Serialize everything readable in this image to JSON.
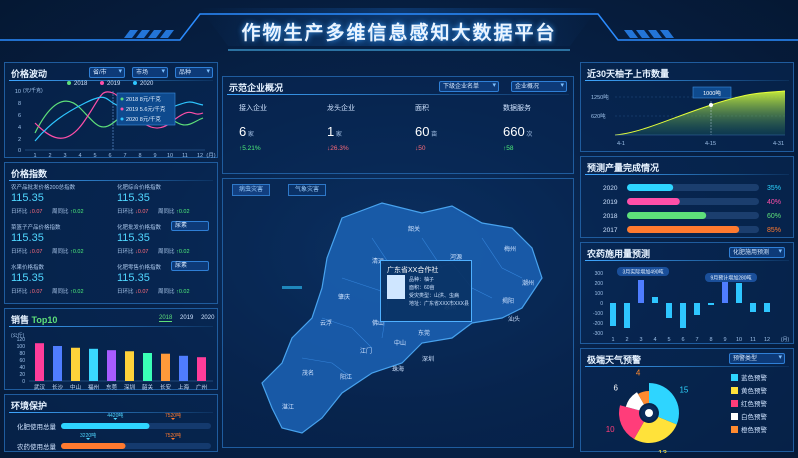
{
  "header": {
    "title": "作物生产多维信息感知大数据平台"
  },
  "price_wave": {
    "title": "价格波动",
    "filters": [
      "省/市",
      "市场",
      "品种"
    ],
    "legend": [
      "2018",
      "2019",
      "2020"
    ],
    "y_unit": "(元/千克)",
    "y_ticks": [
      "10",
      "8",
      "6",
      "4",
      "2",
      "0"
    ],
    "x_ticks": [
      "1",
      "2",
      "3",
      "4",
      "5",
      "6",
      "7",
      "8",
      "9",
      "10",
      "11",
      "12"
    ],
    "x_unit": "(月)",
    "tooltip": [
      "2018  8元/千克",
      "2019  5.6元/千克",
      "2020  8元/千克"
    ],
    "colors": [
      "#5ee07a",
      "#ff4fa8",
      "#2ec6ff"
    ]
  },
  "price_index": {
    "title": "价格指数",
    "items": [
      {
        "name": "农产品批发价格200总指数",
        "value": "115.35",
        "d_label": "日环比",
        "d_val": "↓0.07",
        "w_label": "周同比",
        "w_val": "↑0.02"
      },
      {
        "name": "化肥综合价格指数",
        "value": "115.35",
        "d_label": "日环比",
        "d_val": "↓0.07",
        "w_label": "周同比",
        "w_val": "↑0.02"
      },
      {
        "name": "菜篮子产品价格指数",
        "value": "115.35",
        "d_label": "日环比",
        "d_val": "↓0.07",
        "w_label": "周同比",
        "w_val": "↑0.02"
      },
      {
        "name": "化肥批发价格指数",
        "value": "115.35",
        "d_label": "日环比",
        "d_val": "↓0.07",
        "w_label": "周同比",
        "w_val": "↑0.02"
      },
      {
        "name": "水果价格指数",
        "value": "115.35",
        "d_label": "日环比",
        "d_val": "↓0.07",
        "w_label": "周同比",
        "w_val": "↑0.02"
      },
      {
        "name": "化肥零售价格指数",
        "value": "115.35",
        "d_label": "日环比",
        "d_val": "↓0.07",
        "w_label": "周同比",
        "w_val": "↑0.02"
      }
    ],
    "select_label": "尿素"
  },
  "sales": {
    "title": "销售 Top10",
    "years": [
      "2018",
      "2019",
      "2020"
    ],
    "y_unit": "(公斤)",
    "y_ticks": [
      "120",
      "100",
      "80",
      "60",
      "40",
      "20",
      "0"
    ],
    "categories": [
      "武汉",
      "长沙",
      "中山",
      "福州",
      "东莞",
      "深圳",
      "韶关",
      "长安",
      "上海",
      "广州"
    ],
    "values": [
      108,
      100,
      95,
      92,
      88,
      85,
      80,
      78,
      72,
      68
    ],
    "colors": [
      "#ff3d9a",
      "#4f7dff",
      "#ffd23a",
      "#3ad7ff",
      "#a85cff",
      "#ffd23a",
      "#3affb6",
      "#ff9a3a",
      "#4f7dff",
      "#ff3d9a"
    ]
  },
  "env": {
    "title": "环境保护",
    "rows": [
      {
        "label": "化肥使用总量",
        "target": "4420吨",
        "actual": "7520吨",
        "ratio": 0.59,
        "color": "#2ed5ff"
      },
      {
        "label": "农药使用总量",
        "target": "3220吨",
        "actual": "7520吨",
        "ratio": 0.43,
        "color": "#ff7a2f"
      }
    ]
  },
  "demo": {
    "title": "示范企业概况",
    "select1": "下级企业名单",
    "select2": "企业概况",
    "stats": [
      {
        "label": "接入企业",
        "value": "6",
        "unit": "家",
        "change": "↑5.21%",
        "dir": "up"
      },
      {
        "label": "龙头企业",
        "value": "1",
        "unit": "家",
        "change": "↓26.3%",
        "dir": "down"
      },
      {
        "label": "面积",
        "value": "60",
        "unit": "亩",
        "change": "↓50",
        "dir": "down"
      },
      {
        "label": "数据服务",
        "value": "660",
        "unit": "次",
        "change": "↑58",
        "dir": "up"
      }
    ]
  },
  "map": {
    "tabs": [
      "病虫灾害",
      "气象灾害"
    ],
    "cities": [
      "韶关",
      "河源",
      "梅州",
      "清远",
      "潮州",
      "肇庆",
      "广州",
      "惠州",
      "揭阳",
      "云浮",
      "佛山",
      "东莞",
      "汕头",
      "江门",
      "中山",
      "深圳",
      "茂名",
      "阳江",
      "珠海",
      "湛江"
    ],
    "popup": {
      "title": "广东省XX合作社",
      "lines": [
        "品种：柚子",
        "面积：60亩",
        "受灾类型：山洪、虫病",
        "地址：广东省XXX市XXX县"
      ]
    }
  },
  "pomelo": {
    "title": "近30天柚子上市数量",
    "y_ticks": [
      "1250吨",
      "620吨"
    ],
    "x_ticks": [
      "4-1",
      "4-15",
      "4-31"
    ],
    "tooltip": "1000吨"
  },
  "forecast": {
    "title": "预测产量完成情况",
    "rows": [
      {
        "year": "2020",
        "pct": "35%",
        "ratio": 0.35,
        "color": "#2ed5ff"
      },
      {
        "year": "2019",
        "pct": "40%",
        "ratio": 0.4,
        "color": "#ff4fa8"
      },
      {
        "year": "2018",
        "pct": "60%",
        "ratio": 0.6,
        "color": "#5ee07a"
      },
      {
        "year": "2017",
        "pct": "85%",
        "ratio": 0.85,
        "color": "#ff7a2f"
      }
    ]
  },
  "pesticide": {
    "title": "农药施用量预测",
    "select": "化肥施用预测",
    "y_ticks": [
      "300",
      "200",
      "100",
      "0",
      "-100",
      "-200",
      "-300"
    ],
    "x_ticks": [
      "1",
      "2",
      "3",
      "4",
      "5",
      "6",
      "7",
      "8",
      "9",
      "10",
      "11",
      "12"
    ],
    "x_unit": "(月)",
    "values": [
      -230,
      -250,
      230,
      60,
      -150,
      -250,
      -120,
      -20,
      260,
      200,
      -90,
      -90
    ],
    "note1": "3月实际增加490吨",
    "note2": "9月预计增加280吨"
  },
  "weather": {
    "title": "极端天气预警",
    "select": "预警类型",
    "legend": [
      "蓝色预警",
      "黄色预警",
      "红色预警",
      "白色预警",
      "橙色预警"
    ],
    "legend_colors": [
      "#2ed5ff",
      "#ffe23a",
      "#ff3d7a",
      "#ffffff",
      "#ff8a2f"
    ],
    "values": [
      15,
      13,
      10,
      6,
      4
    ],
    "labels": [
      "15",
      "13",
      "10",
      "6",
      "4"
    ]
  }
}
